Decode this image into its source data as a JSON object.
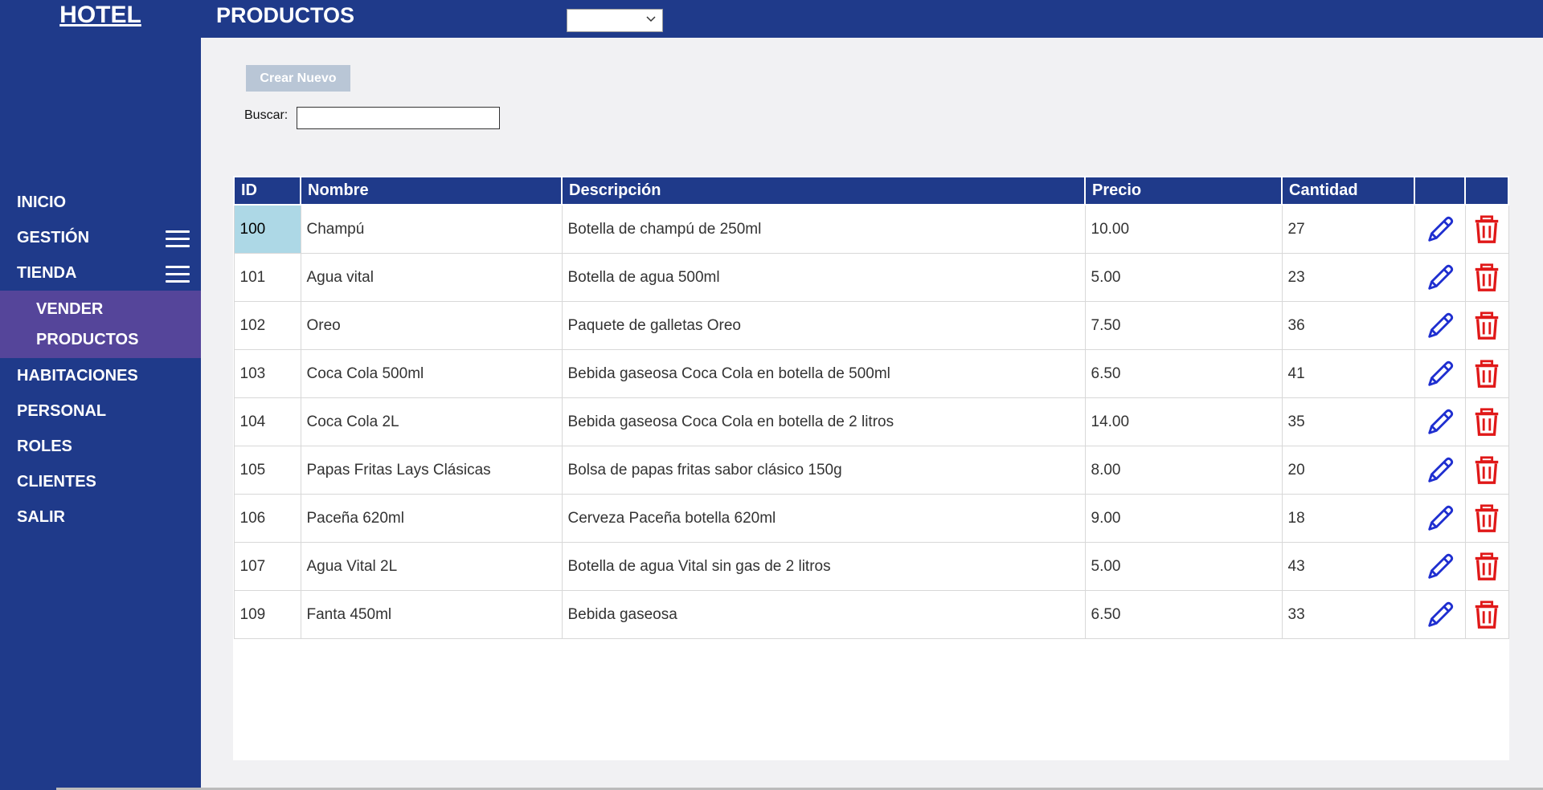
{
  "brand": "HOTEL",
  "header": {
    "title": "PRODUCTOS",
    "select_value": ""
  },
  "sidebar": {
    "items": [
      {
        "label": "INICIO"
      },
      {
        "label": "GESTIÓN"
      },
      {
        "label": "TIENDA"
      },
      {
        "label": "HABITACIONES"
      },
      {
        "label": "PERSONAL"
      },
      {
        "label": "ROLES"
      },
      {
        "label": "CLIENTES"
      },
      {
        "label": "SALIR"
      }
    ],
    "submenu": [
      {
        "label": "VENDER"
      },
      {
        "label": "PRODUCTOS"
      }
    ]
  },
  "toolbar": {
    "new_label": "Crear Nuevo",
    "search_label": "Buscar:",
    "search_value": ""
  },
  "table": {
    "headers": [
      "ID",
      "Nombre",
      "Descripción",
      "Precio",
      "Cantidad",
      "",
      ""
    ],
    "rows": [
      {
        "id": "100",
        "nombre": "Champú",
        "descripcion": "Botella de champú de 250ml",
        "precio": "10.00",
        "cantidad": "27"
      },
      {
        "id": "101",
        "nombre": "Agua vital",
        "descripcion": "Botella de agua 500ml",
        "precio": "5.00",
        "cantidad": "23"
      },
      {
        "id": "102",
        "nombre": "Oreo",
        "descripcion": "Paquete de galletas Oreo",
        "precio": "7.50",
        "cantidad": "36"
      },
      {
        "id": "103",
        "nombre": "Coca Cola 500ml",
        "descripcion": "Bebida gaseosa Coca Cola en botella de 500ml",
        "precio": "6.50",
        "cantidad": "41"
      },
      {
        "id": "104",
        "nombre": "Coca Cola 2L",
        "descripcion": "Bebida gaseosa Coca Cola en botella de 2 litros",
        "precio": "14.00",
        "cantidad": "35"
      },
      {
        "id": "105",
        "nombre": "Papas Fritas Lays Clásicas",
        "descripcion": "Bolsa de papas fritas sabor clásico 150g",
        "precio": "8.00",
        "cantidad": "20"
      },
      {
        "id": "106",
        "nombre": "Paceña 620ml",
        "descripcion": "Cerveza Paceña botella 620ml",
        "precio": "9.00",
        "cantidad": "18"
      },
      {
        "id": "107",
        "nombre": "Agua Vital 2L",
        "descripcion": "Botella de agua Vital sin gas de 2 litros",
        "precio": "5.00",
        "cantidad": "43"
      },
      {
        "id": "109",
        "nombre": "Fanta 450ml",
        "descripcion": "Bebida gaseosa",
        "precio": "6.50",
        "cantidad": "33"
      }
    ]
  },
  "icons": {
    "edit": "pencil-icon",
    "delete": "trash-icon",
    "menu": "hamburger-icon",
    "dropdown": "chevron-down-icon"
  },
  "colors": {
    "primary": "#1f3a8a",
    "submenu": "#55459a",
    "edit_icon": "#1f2fd0",
    "delete_icon": "#e01818",
    "selected_cell": "#add8e6"
  }
}
